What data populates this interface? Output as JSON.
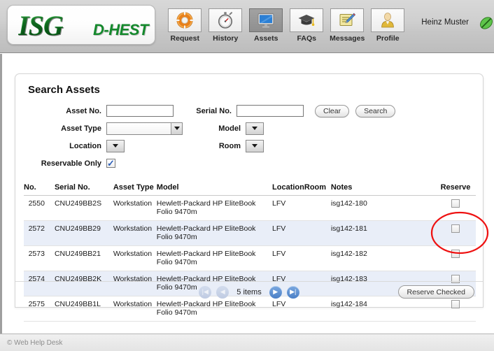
{
  "header": {
    "logo": {
      "primary": "ISG",
      "secondary": "D-HEST"
    },
    "nav": [
      {
        "label": "Request",
        "icon": "lifering-icon",
        "active": false
      },
      {
        "label": "History",
        "icon": "stopwatch-icon",
        "active": false
      },
      {
        "label": "Assets",
        "icon": "monitor-icon",
        "active": true
      },
      {
        "label": "FAQs",
        "icon": "graduation-cap-icon",
        "active": false
      },
      {
        "label": "Messages",
        "icon": "notepad-pencil-icon",
        "active": false
      },
      {
        "label": "Profile",
        "icon": "person-icon",
        "active": false
      }
    ],
    "user_name": "Heinz Muster",
    "logout_icon": "green-leaf-icon"
  },
  "search_panel": {
    "title": "Search Assets",
    "fields": {
      "asset_no_label": "Asset No.",
      "asset_no_value": "",
      "serial_no_label": "Serial No.",
      "serial_no_value": "",
      "asset_type_label": "Asset Type",
      "asset_type_value": "",
      "model_label": "Model",
      "model_value": "",
      "location_label": "Location",
      "location_value": "",
      "room_label": "Room",
      "room_value": "",
      "reservable_only_label": "Reservable Only",
      "reservable_only_checked": true
    },
    "buttons": {
      "clear": "Clear",
      "search": "Search"
    }
  },
  "results": {
    "columns": [
      "No.",
      "Serial No.",
      "Asset Type",
      "Model",
      "Location",
      "Room",
      "Notes",
      "Reserve"
    ],
    "rows": [
      {
        "no": "2550",
        "serial": "CNU249BB2S",
        "type": "Workstation",
        "model": "Hewlett-Packard HP EliteBook Folio 9470m",
        "location": "LFV",
        "room": "",
        "notes": "isg142-180",
        "reserved": false
      },
      {
        "no": "2572",
        "serial": "CNU249BB29",
        "type": "Workstation",
        "model": "Hewlett-Packard HP EliteBook Folio 9470m",
        "location": "LFV",
        "room": "",
        "notes": "isg142-181",
        "reserved": false
      },
      {
        "no": "2573",
        "serial": "CNU249BB21",
        "type": "Workstation",
        "model": "Hewlett-Packard HP EliteBook Folio 9470m",
        "location": "LFV",
        "room": "",
        "notes": "isg142-182",
        "reserved": false
      },
      {
        "no": "2574",
        "serial": "CNU249BB2K",
        "type": "Workstation",
        "model": "Hewlett-Packard HP EliteBook Folio 9470m",
        "location": "LFV",
        "room": "",
        "notes": "isg142-183",
        "reserved": false
      },
      {
        "no": "2575",
        "serial": "CNU249BB1L",
        "type": "Workstation",
        "model": "Hewlett-Packard HP EliteBook Folio 9470m",
        "location": "LFV",
        "room": "",
        "notes": "isg142-184",
        "reserved": false
      }
    ]
  },
  "pager": {
    "first_icon": "first-page-icon",
    "prev_icon": "previous-page-icon",
    "count_label": "5 items",
    "next_icon": "next-page-icon",
    "last_icon": "last-page-icon",
    "first_enabled": false,
    "prev_enabled": false,
    "next_enabled": true,
    "last_enabled": true,
    "reserve_checked_label": "Reserve Checked"
  },
  "annotation": {
    "shape": "ellipse",
    "color": "#ee1111",
    "target": "reserve-column"
  },
  "footer": {
    "text": "© Web Help Desk"
  }
}
